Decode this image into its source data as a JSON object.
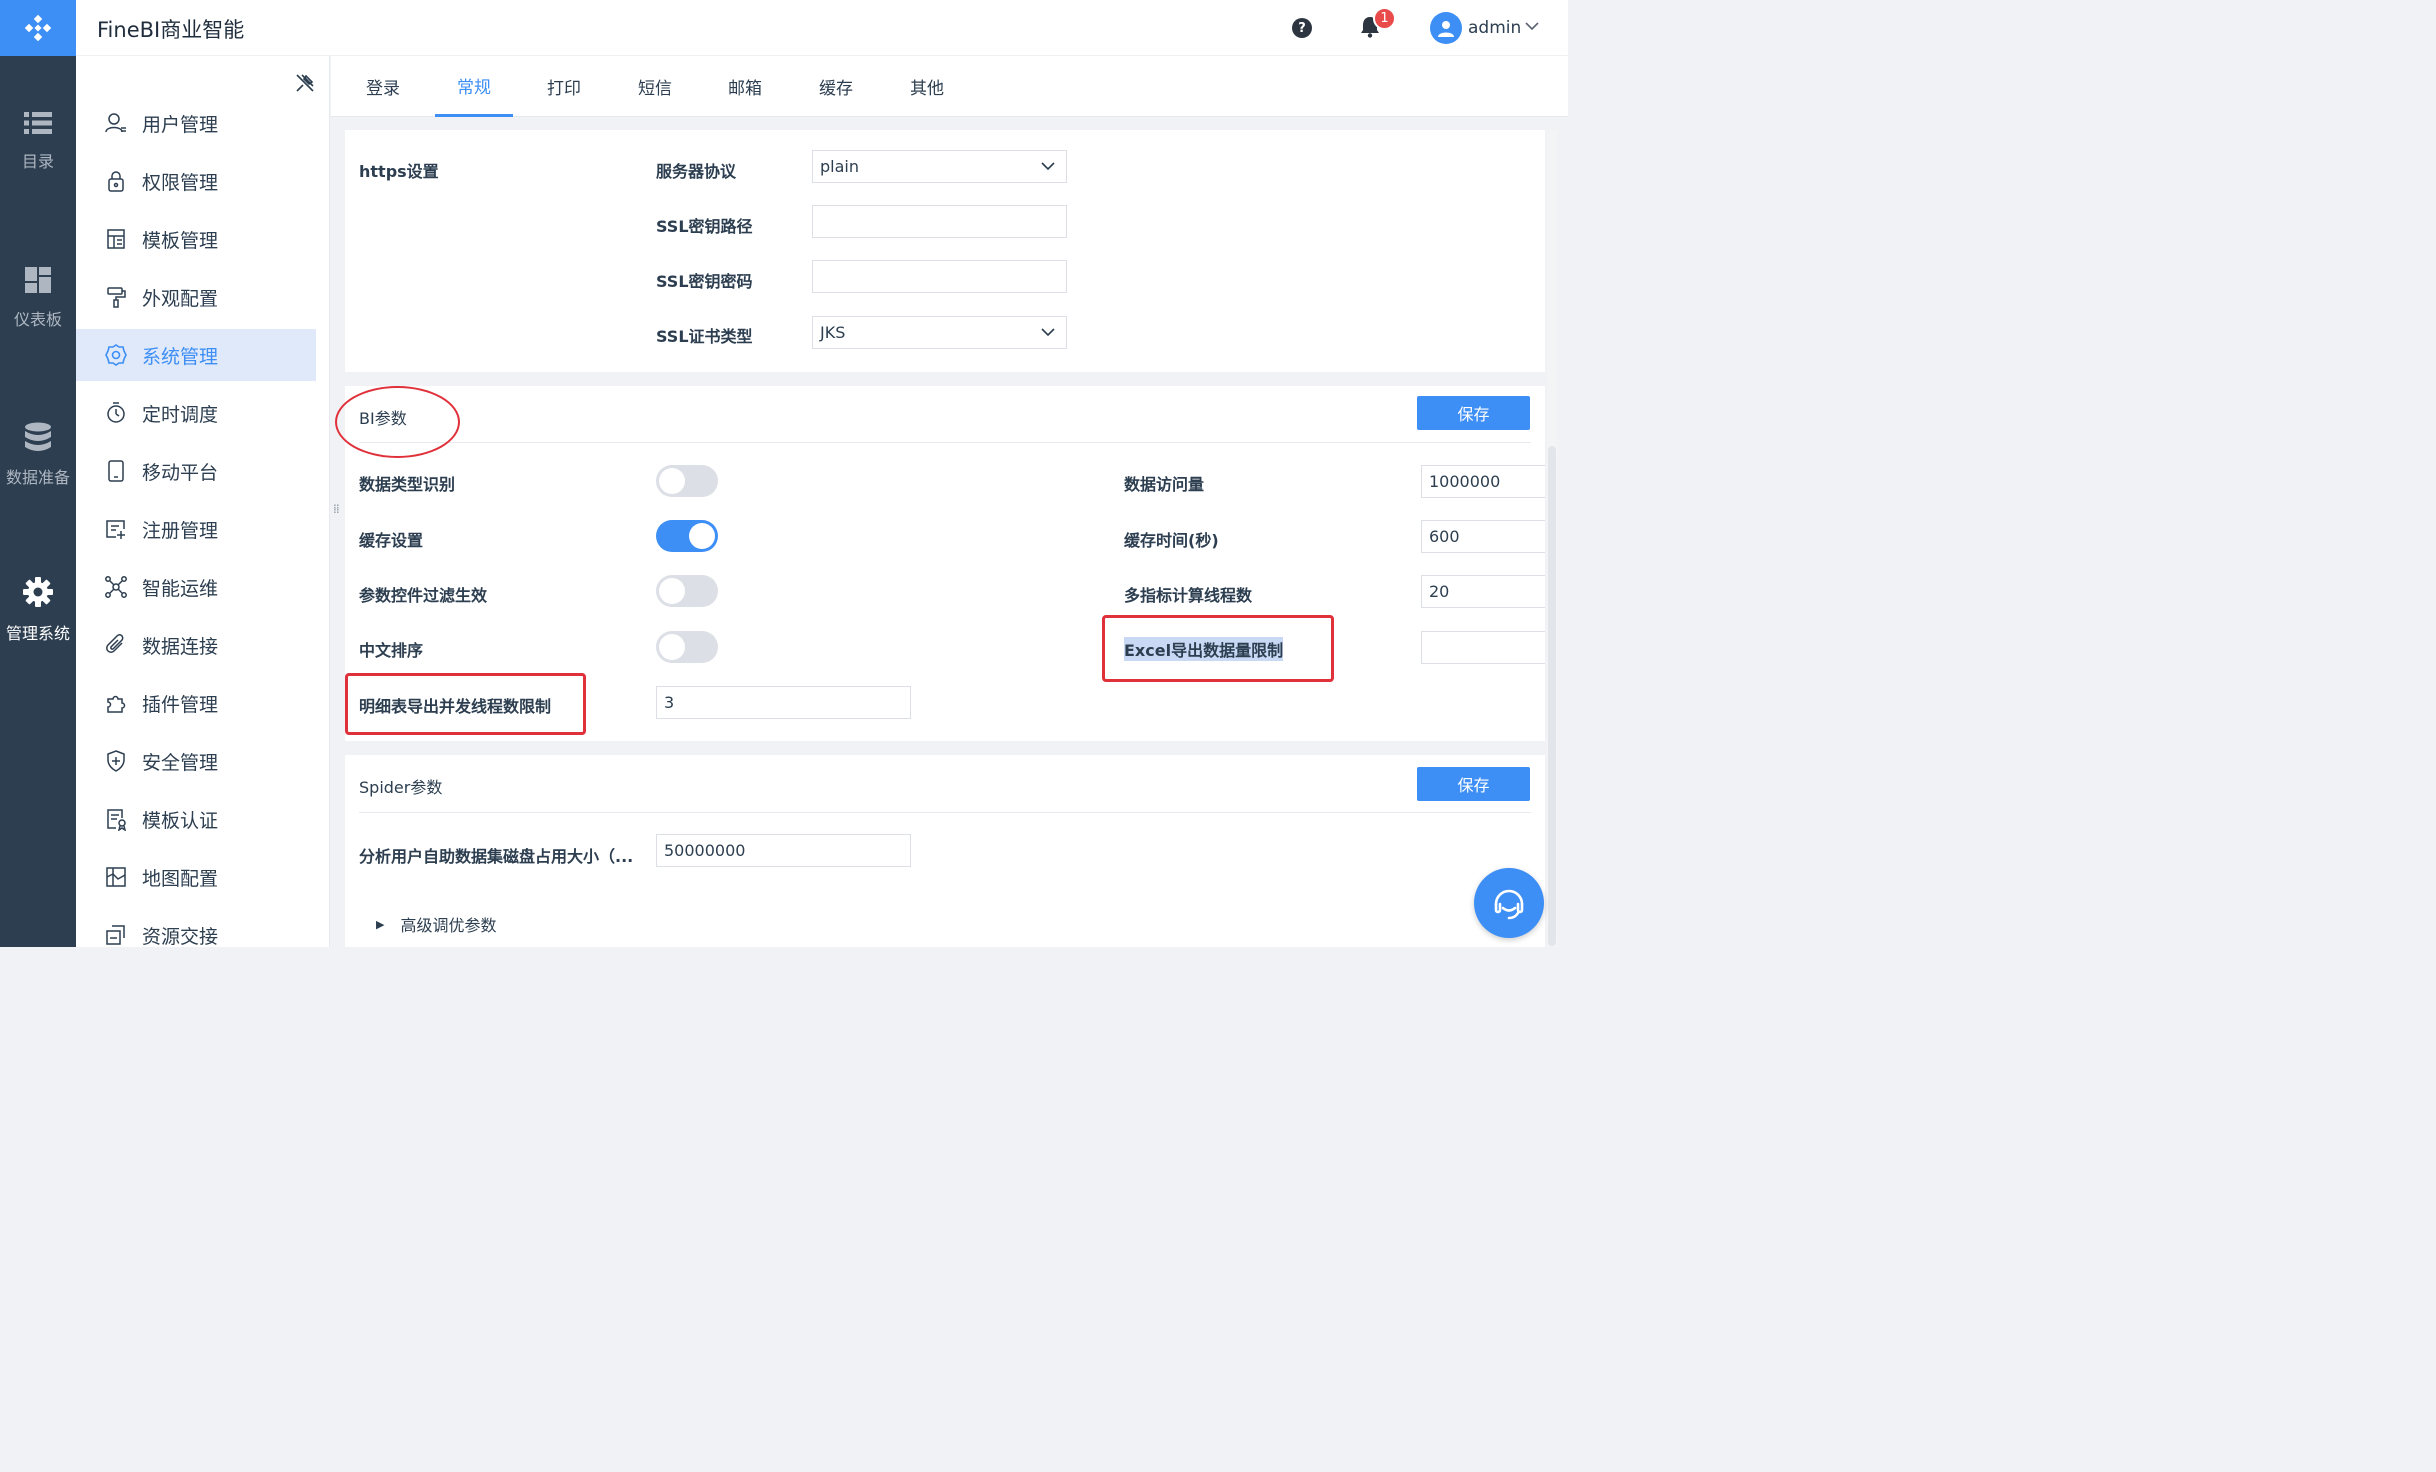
{
  "app": {
    "title": "FineBI商业智能"
  },
  "header": {
    "help_icon": "?",
    "notifications_count": "1",
    "user_name": "admin"
  },
  "rail": [
    {
      "label": "目录",
      "icon": "list-icon"
    },
    {
      "label": "仪表板",
      "icon": "dashboard-icon"
    },
    {
      "label": "数据准备",
      "icon": "database-icon"
    },
    {
      "label": "管理系统",
      "icon": "gear-icon"
    }
  ],
  "sidebar": {
    "items": [
      {
        "label": "用户管理",
        "icon": "user-icon"
      },
      {
        "label": "权限管理",
        "icon": "lock-icon"
      },
      {
        "label": "模板管理",
        "icon": "template-icon"
      },
      {
        "label": "外观配置",
        "icon": "paint-roller-icon"
      },
      {
        "label": "系统管理",
        "icon": "settings-icon"
      },
      {
        "label": "定时调度",
        "icon": "timer-icon"
      },
      {
        "label": "移动平台",
        "icon": "tablet-icon"
      },
      {
        "label": "注册管理",
        "icon": "register-icon"
      },
      {
        "label": "智能运维",
        "icon": "network-icon"
      },
      {
        "label": "数据连接",
        "icon": "paperclip-icon"
      },
      {
        "label": "插件管理",
        "icon": "puzzle-icon"
      },
      {
        "label": "安全管理",
        "icon": "shield-icon"
      },
      {
        "label": "模板认证",
        "icon": "certificate-icon"
      },
      {
        "label": "地图配置",
        "icon": "map-icon"
      },
      {
        "label": "资源交接",
        "icon": "handover-icon"
      }
    ],
    "active": "系统管理"
  },
  "tabs": [
    "登录",
    "常规",
    "打印",
    "短信",
    "邮箱",
    "缓存",
    "其他"
  ],
  "active_tab": "常规",
  "https": {
    "section_label": "https设置",
    "protocol_label": "服务器协议",
    "protocol_value": "plain",
    "ssl_key_path_label": "SSL密钥路径",
    "ssl_key_path_value": "",
    "ssl_key_password_label": "SSL密钥密码",
    "ssl_key_password_value": "",
    "ssl_cert_type_label": "SSL证书类型",
    "ssl_cert_type_value": "JKS"
  },
  "bi": {
    "title": "BI参数",
    "save_label": "保存",
    "data_type_detect_label": "数据类型识别",
    "data_type_detect_on": false,
    "cache_setting_label": "缓存设置",
    "cache_setting_on": true,
    "param_filter_label": "参数控件过滤生效",
    "param_filter_on": false,
    "chinese_sort_label": "中文排序",
    "chinese_sort_on": false,
    "detail_export_threads_label": "明细表导出并发线程数限制",
    "detail_export_threads_value": "3",
    "data_access_label": "数据访问量",
    "data_access_value": "1000000",
    "cache_time_label": "缓存时间(秒)",
    "cache_time_value": "600",
    "multi_metric_threads_label": "多指标计算线程数",
    "multi_metric_threads_value": "20",
    "excel_export_limit_label": "Excel导出数据量限制",
    "excel_export_limit_value": ""
  },
  "spider": {
    "title": "Spider参数",
    "save_label": "保存",
    "disk_usage_label": "分析用户自助数据集磁盘占用大小（...",
    "disk_usage_value": "50000000",
    "advanced_label": "高级调优参数"
  },
  "colors": {
    "accent": "#3d8ef5",
    "rail": "#2c3e50",
    "annotation": "#e0303a"
  }
}
